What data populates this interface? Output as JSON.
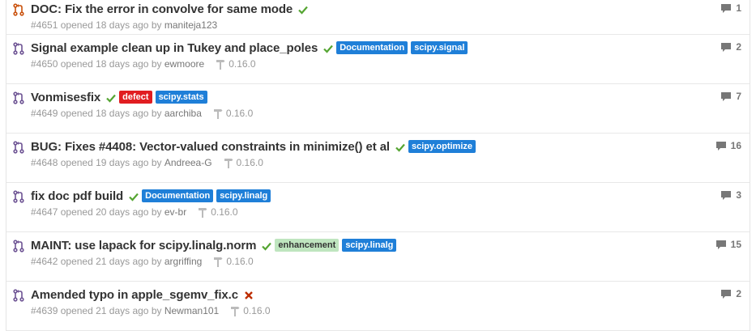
{
  "pull_requests": [
    {
      "title": "DOC: Fix the error in convolve for same mode",
      "status": "success",
      "labels": [],
      "number": "#4651",
      "opened_text": "opened 18 days ago by",
      "author": "maniteja123",
      "milestone": "",
      "comments": "1",
      "icon_color": "#c9510c"
    },
    {
      "title": "Signal example clean up in Tukey and place_poles",
      "status": "success",
      "labels": [
        {
          "text": "Documentation",
          "color": "#1f7fd8"
        },
        {
          "text": "scipy.signal",
          "color": "#1f7fd8"
        }
      ],
      "number": "#4650",
      "opened_text": "opened 18 days ago by",
      "author": "ewmoore",
      "milestone": "0.16.0",
      "comments": "2",
      "icon_color": "#6e5494"
    },
    {
      "title": "Vonmisesfix",
      "status": "success",
      "labels": [
        {
          "text": "defect",
          "color": "#e11d21"
        },
        {
          "text": "scipy.stats",
          "color": "#1f7fd8"
        }
      ],
      "number": "#4649",
      "opened_text": "opened 18 days ago by",
      "author": "aarchiba",
      "milestone": "0.16.0",
      "comments": "7",
      "icon_color": "#6e5494"
    },
    {
      "title": "BUG: Fixes #4408: Vector-valued constraints in minimize() et al",
      "status": "success",
      "labels": [
        {
          "text": "scipy.optimize",
          "color": "#1f7fd8"
        }
      ],
      "number": "#4648",
      "opened_text": "opened 19 days ago by",
      "author": "Andreea-G",
      "milestone": "0.16.0",
      "comments": "16",
      "icon_color": "#6e5494"
    },
    {
      "title": "fix doc pdf build",
      "status": "success",
      "labels": [
        {
          "text": "Documentation",
          "color": "#1f7fd8"
        },
        {
          "text": "scipy.linalg",
          "color": "#1f7fd8"
        }
      ],
      "number": "#4647",
      "opened_text": "opened 20 days ago by",
      "author": "ev-br",
      "milestone": "0.16.0",
      "comments": "3",
      "icon_color": "#6e5494"
    },
    {
      "title": "MAINT: use lapack for scipy.linalg.norm",
      "status": "success",
      "labels": [
        {
          "text": "enhancement",
          "color": "#bfe5bf",
          "text_color": "#333333"
        },
        {
          "text": "scipy.linalg",
          "color": "#1f7fd8"
        }
      ],
      "number": "#4642",
      "opened_text": "opened 21 days ago by",
      "author": "argriffing",
      "milestone": "0.16.0",
      "comments": "15",
      "icon_color": "#6e5494"
    },
    {
      "title": "Amended typo in apple_sgemv_fix.c",
      "status": "failure",
      "labels": [],
      "number": "#4639",
      "opened_text": "opened 21 days ago by",
      "author": "Newman101",
      "milestone": "0.16.0",
      "comments": "2",
      "icon_color": "#6e5494"
    }
  ],
  "colors": {
    "success": "#55a532",
    "failure": "#bd2c00"
  }
}
